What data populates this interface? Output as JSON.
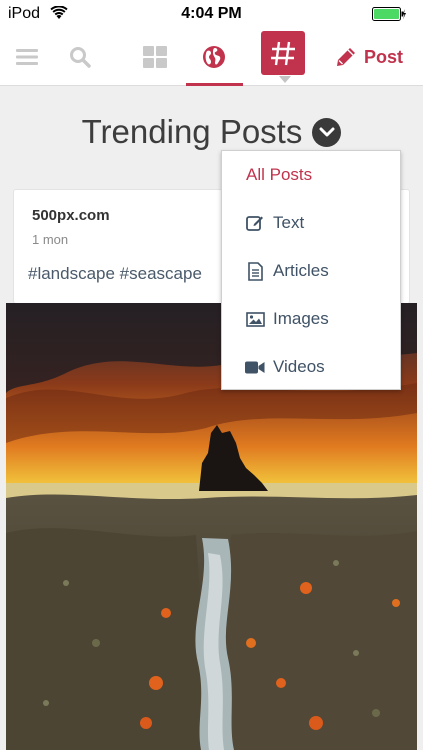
{
  "status_bar": {
    "carrier": "iPod",
    "time": "4:04 PM"
  },
  "nav": {
    "post_label": "Post",
    "logo_glyph": "#",
    "accent_color": "#c1334c",
    "icons": [
      "menu-icon",
      "search-icon",
      "grid-icon",
      "globe-icon",
      "app-logo-icon",
      "pencil-icon"
    ]
  },
  "page": {
    "title": "Trending Posts"
  },
  "post": {
    "author": "500px.com",
    "age": "1 mon",
    "tags": "#landscape #seascape"
  },
  "dropdown": {
    "items": [
      {
        "label": "All Posts",
        "icon": ""
      },
      {
        "label": "Text",
        "icon": "edit-icon"
      },
      {
        "label": "Articles",
        "icon": "document-icon"
      },
      {
        "label": "Images",
        "icon": "image-icon"
      },
      {
        "label": "Videos",
        "icon": "video-camera-icon"
      }
    ],
    "selected": "All Posts"
  }
}
